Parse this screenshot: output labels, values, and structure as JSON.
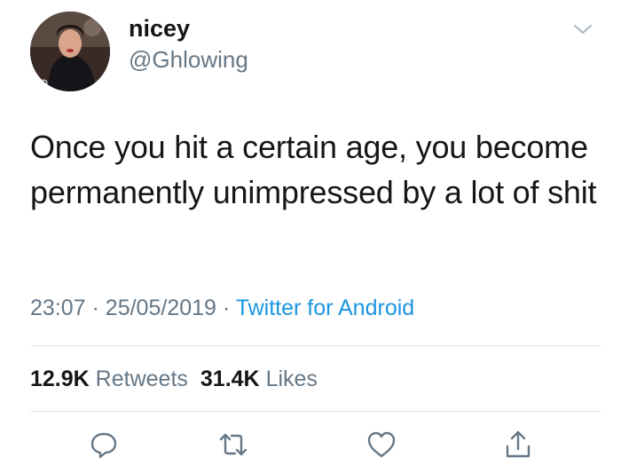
{
  "user": {
    "display_name": "nicey",
    "handle": "@Ghlowing"
  },
  "tweet": {
    "text": "Once you hit a certain age, you become permanently unimpressed by a lot of shit",
    "time": "23:07",
    "separator": "·",
    "date": "25/05/2019",
    "source": "Twitter for Android"
  },
  "stats": {
    "retweets_count": "12.9K",
    "retweets_label": "Retweets",
    "likes_count": "31.4K",
    "likes_label": "Likes"
  },
  "actions": [
    "reply-icon",
    "retweet-icon",
    "like-icon",
    "share-icon"
  ],
  "colors": {
    "text": "#14171a",
    "secondary": "#657786",
    "link": "#1b95e0",
    "divider": "#e1e8ed"
  }
}
